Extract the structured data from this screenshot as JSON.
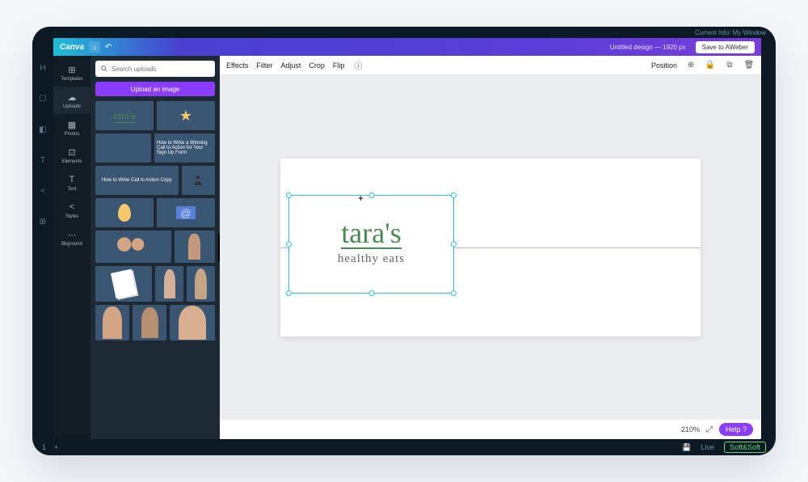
{
  "outer": {
    "top_right": "Current Info: My Window",
    "bottom_left_items": [
      "1",
      "+"
    ],
    "bottom_right_save_icon": "💾",
    "bottom_right_live": "Live",
    "bottom_right_tag": "Soft&Soft"
  },
  "vrail": {
    "items": [
      "H",
      "☐",
      "◧",
      "T",
      "<",
      "⊞"
    ]
  },
  "topbar": {
    "logo": "Canva",
    "home_icon": "⌂",
    "undo_icon": "↶",
    "doc_title": "Untitled design — 1920 px",
    "save_btn": "Save to AWeber"
  },
  "siderail": {
    "items": [
      {
        "icon": "⊞",
        "label": "Templates"
      },
      {
        "icon": "☁",
        "label": "Uploads"
      },
      {
        "icon": "▦",
        "label": "Photos"
      },
      {
        "icon": "⊡",
        "label": "Elements"
      },
      {
        "icon": "T",
        "label": "Text"
      },
      {
        "icon": "<",
        "label": "Styles"
      },
      {
        "icon": "⋯",
        "label": "Bkground"
      }
    ],
    "active_index": 1
  },
  "panel": {
    "search_placeholder": "Search uploads",
    "upload_btn": "Upload an image",
    "collapse_icon": "‹",
    "thumbs": {
      "taras_text": "tara's",
      "yellow_text": "How to Write a Winning Call to Action for Your Sign Up Form",
      "blue_text": "How to Write Call to Action Copy"
    }
  },
  "canvas_toolbar": {
    "items": [
      "Effects",
      "Filter",
      "Adjust",
      "Crop",
      "Flip"
    ],
    "info_icon": "ⓘ",
    "position": "Position",
    "right_icons": [
      "⊕",
      "🔒",
      "⧉",
      "🗑"
    ]
  },
  "canvas": {
    "logo_main": "tara's",
    "logo_sub": "healthy eats",
    "cursor": "+"
  },
  "footer": {
    "zoom": "210%",
    "fullscreen_icon": "⤢",
    "help": "Help ?"
  }
}
